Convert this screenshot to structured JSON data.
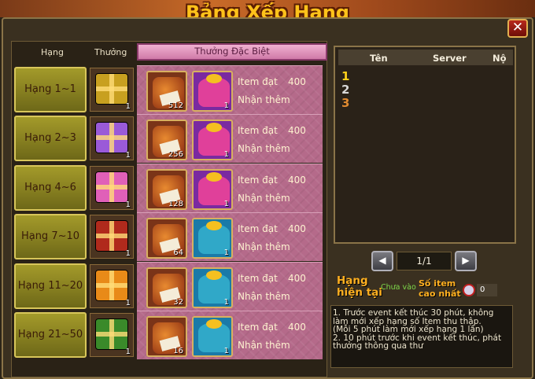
{
  "title": "Bảng Xếp Hạng",
  "close_label": "✕",
  "headers": {
    "rank": "Hạng",
    "reward": "Thưởng",
    "special": "Thưởng Đặc Biệt"
  },
  "rows": [
    {
      "rank": "Hạng 1~1",
      "box_color": "#c8a020",
      "box_count": "1",
      "scroll_count": "512",
      "gift_color": "#e0409a",
      "gift_bg": "#7a2aa0",
      "gift_count": "1",
      "item_label": "Item đạt",
      "item_value": "400",
      "bonus_label": "Nhận thêm"
    },
    {
      "rank": "Hạng 2~3",
      "box_color": "#9a5ad8",
      "box_count": "1",
      "scroll_count": "256",
      "gift_color": "#e0409a",
      "gift_bg": "#7a2aa0",
      "gift_count": "1",
      "item_label": "Item đạt",
      "item_value": "400",
      "bonus_label": "Nhận thêm"
    },
    {
      "rank": "Hạng 4~6",
      "box_color": "#e060b8",
      "box_count": "1",
      "scroll_count": "128",
      "gift_color": "#e0409a",
      "gift_bg": "#7a2aa0",
      "gift_count": "1",
      "item_label": "Item đạt",
      "item_value": "400",
      "bonus_label": "Nhận thêm"
    },
    {
      "rank": "Hạng 7~10",
      "box_color": "#b02a1c",
      "box_count": "1",
      "scroll_count": "64",
      "gift_color": "#30a8c8",
      "gift_bg": "#1a7aa8",
      "gift_count": "1",
      "item_label": "Item đạt",
      "item_value": "400",
      "bonus_label": "Nhận thêm"
    },
    {
      "rank": "Hạng 11~20",
      "box_color": "#e88a18",
      "box_count": "1",
      "scroll_count": "32",
      "gift_color": "#30a8c8",
      "gift_bg": "#1a7aa8",
      "gift_count": "1",
      "item_label": "Item đạt",
      "item_value": "400",
      "bonus_label": "Nhận thêm"
    },
    {
      "rank": "Hạng 21~50",
      "box_color": "#3a8a2a",
      "box_count": "1",
      "scroll_count": "16",
      "gift_color": "#30a8c8",
      "gift_bg": "#1a7aa8",
      "gift_count": "1",
      "item_label": "Item đạt",
      "item_value": "400",
      "bonus_label": "Nhận thêm"
    }
  ],
  "leaderboard": {
    "col_name": "Tên",
    "col_server": "Server",
    "col_no": "Nộ",
    "ranks": [
      {
        "num": "1",
        "color": "#ffd21a"
      },
      {
        "num": "2",
        "color": "#d8d8d8"
      },
      {
        "num": "3",
        "color": "#e08a30"
      }
    ]
  },
  "pager": {
    "prev": "◀",
    "page": "1/1",
    "next": "▶"
  },
  "status": {
    "current_rank_label": "Hạng\nhiện tại",
    "current_rank_value": "Chưa vào",
    "top_items_label": "Số item\ncao nhất",
    "top_items_value": "0"
  },
  "notes": [
    "1. Trước event kết thúc 30 phút, không",
    "làm mới xếp hạng số Item thu thập.",
    "(Mỗi 5 phút làm mới xếp hạng 1 lần)",
    "2. 10 phút trước khi event kết thúc, phát",
    "thưởng thông qua thư"
  ]
}
